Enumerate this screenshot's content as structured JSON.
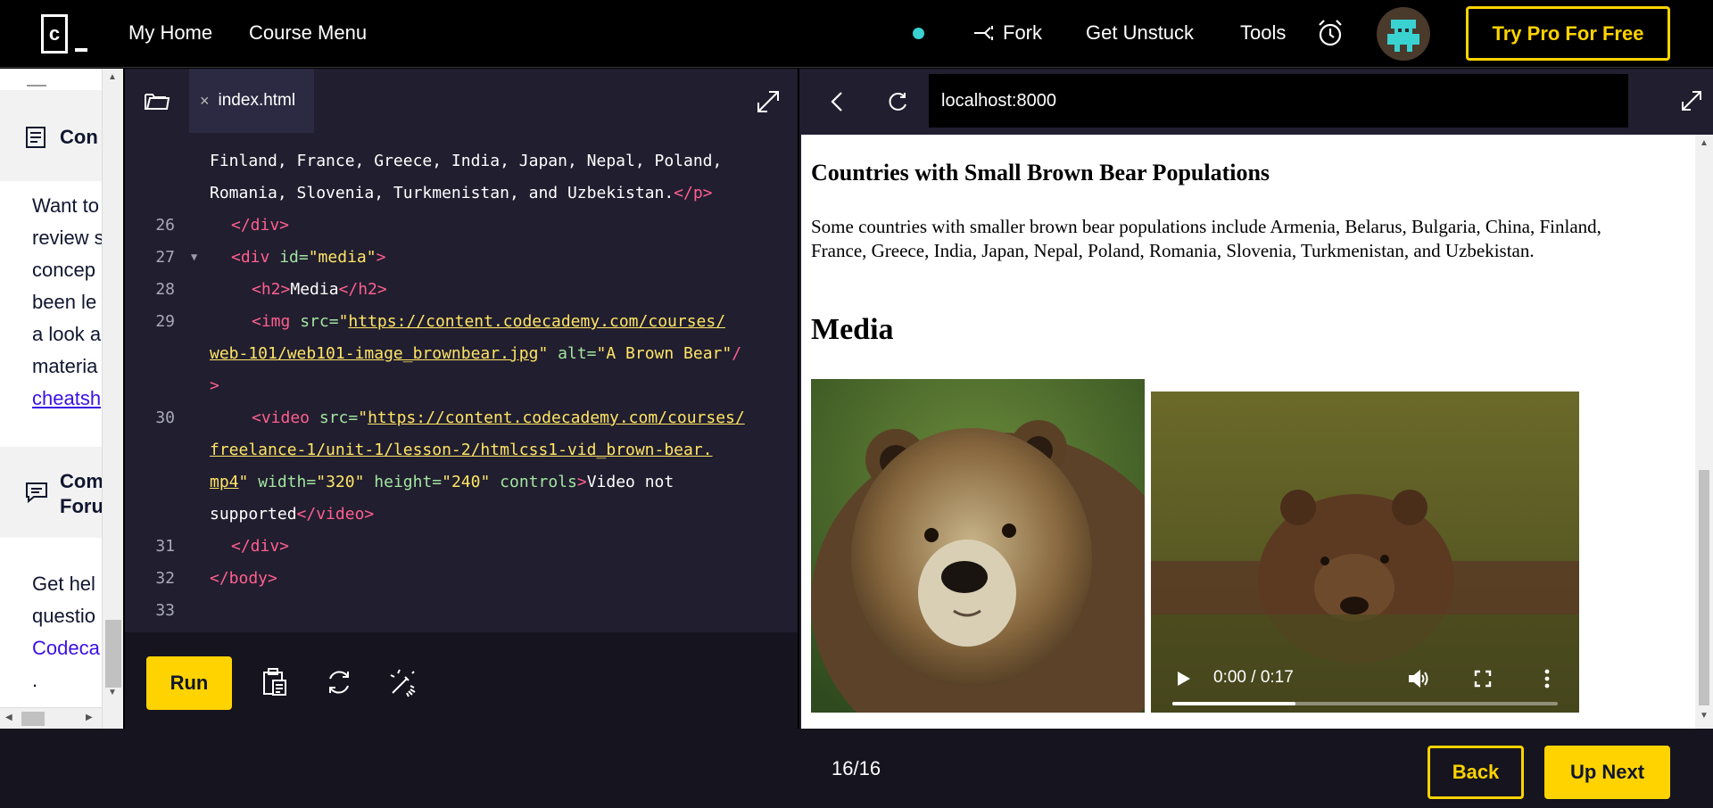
{
  "topbar": {
    "logo_letter": "c",
    "nav": [
      "My Home",
      "Course Menu"
    ],
    "fork_label": "Fork",
    "get_unstuck_label": "Get Unstuck",
    "tools_label": "Tools",
    "pro_button": "Try Pro For Free",
    "status_color": "#3ad1d1",
    "accent": "#ffd300"
  },
  "left_panel": {
    "section1_title": "Con",
    "section1_lines": [
      "Want to",
      "review s",
      "concep",
      "been le",
      "a look a",
      "materia"
    ],
    "section1_link": "cheatsh",
    "section2_title_1": "Com",
    "section2_title_2": "Foru",
    "section2_lines": [
      "Get hel",
      "questio"
    ],
    "section2_link": "Codeca",
    "trailing": "."
  },
  "editor": {
    "tab_label": "index.html",
    "close_glyph": "×",
    "line_numbers": [
      "26",
      "27",
      "28",
      "29",
      "30",
      "31",
      "32",
      "33"
    ],
    "code": {
      "wrap1": "Finland, France, Greece, India, Japan, Nepal, Poland,",
      "wrap2_text": "Romania, Slovenia, Turkmenistan, and Uzbekistan.",
      "wrap2_tag": "</p>",
      "l26": "</div>",
      "l27_open": "<div",
      "l27_attr": "id=",
      "l27_val": "\"media\"",
      "l27_close": ">",
      "l28_open": "<h2>",
      "l28_text": "Media",
      "l28_close": "</h2>",
      "l29_open": "<img",
      "l29_attr": "src=",
      "l29_q": "\"",
      "l29_url1": "https://content.codecademy.com/courses/",
      "l29_url2": "web-101/web101-image_brownbear.jpg",
      "l29_alt": "alt=",
      "l29_altval": "\"A Brown Bear\"",
      "l29_slash": "/",
      "l29_end": ">",
      "l30_open": "<video",
      "l30_attr": "src=",
      "l30_q": "\"",
      "l30_url1": "https://content.codecademy.com/courses/",
      "l30_url2": "freelance-1/unit-1/lesson-2/htmlcss1-vid_brown-bear.",
      "l30_url3": "mp4",
      "l30_w": "width=",
      "l30_wv": "\"320\"",
      "l30_h": "height=",
      "l30_hv": "\"240\"",
      "l30_c": "controls",
      "l30_gt": ">",
      "l30_text1": "Video not",
      "l30_text2": "supported",
      "l30_close": "</video>",
      "l31": "</div>",
      "l32": "</body>"
    },
    "run_label": "Run"
  },
  "browser": {
    "url": "localhost:8000",
    "heading": "Countries with Small Brown Bear Populations",
    "paragraph": "Some countries with smaller brown bear populations include Armenia, Belarus, Bulgaria, China, Finland, France, Greece, India, Japan, Nepal, Poland, Romania, Slovenia, Turkmenistan, and Uzbekistan.",
    "media_heading": "Media",
    "video_time": "0:00 / 0:17",
    "video_progress_fraction": 0.32
  },
  "footer": {
    "progress": "16/16",
    "back_label": "Back",
    "next_label": "Up Next"
  }
}
